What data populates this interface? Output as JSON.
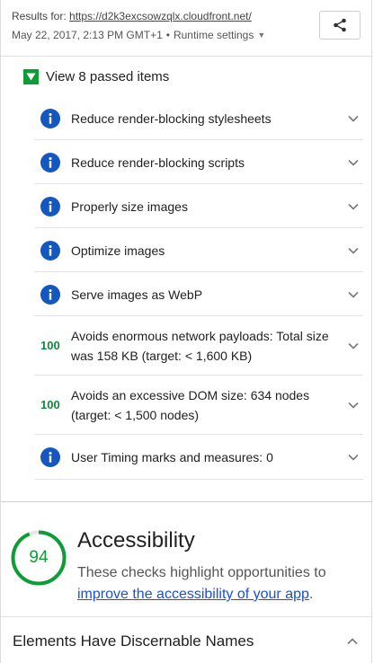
{
  "header": {
    "results_prefix": "Results for: ",
    "url": "https://d2k3excsowzqlx.cloudfront.net/",
    "date": "May 22, 2017, 2:13 PM GMT+1",
    "separator": "•",
    "runtime_settings": "Runtime settings"
  },
  "passed": {
    "toggle_label": "View 8 passed items",
    "items": [
      {
        "kind": "info",
        "title": "Reduce render-blocking stylesheets"
      },
      {
        "kind": "info",
        "title": "Reduce render-blocking scripts"
      },
      {
        "kind": "info",
        "title": "Properly size images"
      },
      {
        "kind": "info",
        "title": "Optimize images"
      },
      {
        "kind": "info",
        "title": "Serve images as WebP"
      },
      {
        "kind": "score",
        "score": "100",
        "title": "Avoids enormous network payloads: Total size was 158 KB (target: < 1,600 KB)"
      },
      {
        "kind": "score",
        "score": "100",
        "title": "Avoids an excessive DOM size: 634 nodes (target: < 1,500 nodes)"
      },
      {
        "kind": "info",
        "title": "User Timing marks and measures: 0"
      }
    ]
  },
  "accessibility": {
    "score": "94",
    "score_value": 94,
    "title": "Accessibility",
    "desc_prefix": "These checks highlight opportunities to ",
    "desc_link": "improve the accessibility of your app",
    "desc_suffix": "."
  },
  "group": {
    "title": "Elements Have Discernable Names"
  },
  "colors": {
    "pass_green": "#0d9d36",
    "info_blue": "#1557c0",
    "link_blue": "#1a4fd6"
  }
}
